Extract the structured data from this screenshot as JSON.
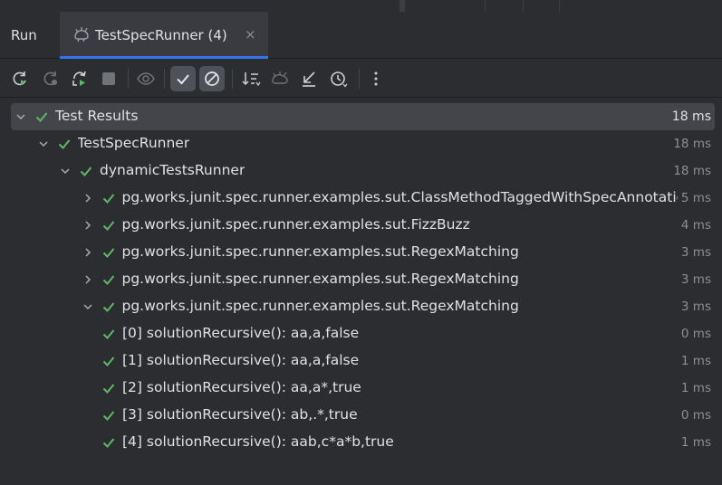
{
  "panel": {
    "run_label": "Run",
    "tab_title": "TestSpecRunner (4)",
    "tab_close": "×"
  },
  "toolbar": {
    "buttons": [
      {
        "icon": "rerun-icon",
        "active": false
      },
      {
        "icon": "rerun-failed-icon",
        "active": false
      },
      {
        "icon": "toggle-auto-test-icon",
        "active": false
      },
      {
        "icon": "stop-icon",
        "active": false
      },
      {
        "icon": "show-ignored-icon",
        "active": false
      },
      {
        "icon": "show-passed-icon",
        "active": true
      },
      {
        "icon": "show-ignored-filter-icon",
        "active": true
      },
      {
        "icon": "sort-icon",
        "active": false
      },
      {
        "icon": "import-tests-icon",
        "active": false
      },
      {
        "icon": "collapse-icon",
        "active": false
      },
      {
        "icon": "history-icon",
        "active": false
      },
      {
        "icon": "more-icon",
        "active": false
      }
    ]
  },
  "colors": {
    "pass": "#5fb865",
    "accent": "#3574f0",
    "muted": "#8c8f94"
  },
  "tree": [
    {
      "label": "Test Results",
      "time": "18 ms",
      "level": 0,
      "expanded": true,
      "expandable": true,
      "selected": true
    },
    {
      "label": "TestSpecRunner",
      "time": "18 ms",
      "level": 1,
      "expanded": true,
      "expandable": true
    },
    {
      "label": "dynamicTestsRunner",
      "time": "18 ms",
      "level": 2,
      "expanded": true,
      "expandable": true
    },
    {
      "label": "pg.works.junit.spec.runner.examples.sut.ClassMethodTaggedWithSpecAnnotation",
      "time": "5 ms",
      "level": 3,
      "expanded": false,
      "expandable": true
    },
    {
      "label": "pg.works.junit.spec.runner.examples.sut.FizzBuzz",
      "time": "4 ms",
      "level": 3,
      "expanded": false,
      "expandable": true
    },
    {
      "label": "pg.works.junit.spec.runner.examples.sut.RegexMatching",
      "time": "3 ms",
      "level": 3,
      "expanded": false,
      "expandable": true
    },
    {
      "label": "pg.works.junit.spec.runner.examples.sut.RegexMatching",
      "time": "3 ms",
      "level": 3,
      "expanded": false,
      "expandable": true
    },
    {
      "label": "pg.works.junit.spec.runner.examples.sut.RegexMatching",
      "time": "3 ms",
      "level": 3,
      "expanded": true,
      "expandable": true
    },
    {
      "label": "[0] solutionRecursive(): aa,a,false",
      "time": "0 ms",
      "level": 4,
      "expandable": false
    },
    {
      "label": "[1] solutionRecursive(): aa,a,false",
      "time": "1 ms",
      "level": 4,
      "expandable": false
    },
    {
      "label": "[2] solutionRecursive(): aa,a*,true",
      "time": "1 ms",
      "level": 4,
      "expandable": false
    },
    {
      "label": "[3] solutionRecursive(): ab,.*,true",
      "time": "0 ms",
      "level": 4,
      "expandable": false
    },
    {
      "label": "[4] solutionRecursive(): aab,c*a*b,true",
      "time": "1 ms",
      "level": 4,
      "expandable": false
    }
  ]
}
